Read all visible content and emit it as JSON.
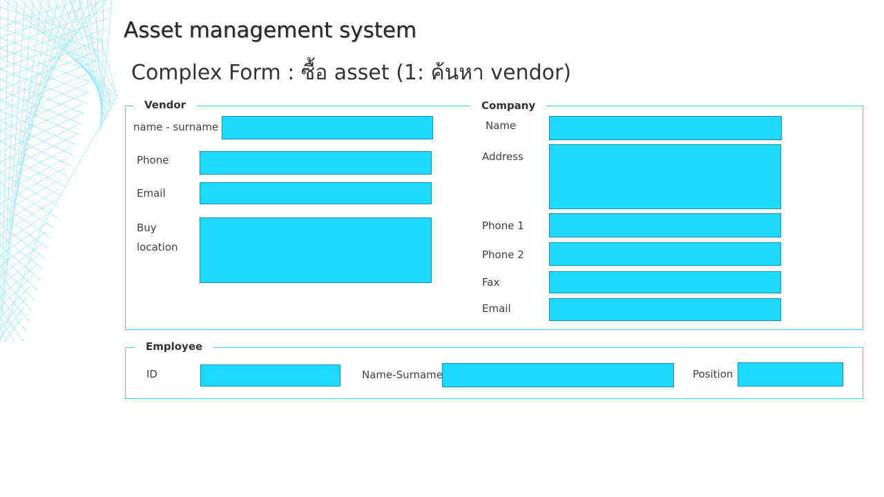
{
  "header": {
    "title": "Asset management system",
    "subtitle": "Complex Form : ซื้อ asset (1: ค้นหา vendor)"
  },
  "vendor": {
    "legend": "Vendor",
    "name_label": "name - surname",
    "name_value": "",
    "phone_label": "Phone",
    "phone_value": "",
    "email_label": "Email",
    "email_value": "",
    "buy_label_1": "Buy",
    "buy_label_2": "location",
    "buy_value": ""
  },
  "company": {
    "legend": "Company",
    "name_label": "Name",
    "name_value": "",
    "address_label": "Address",
    "address_value": "",
    "phone1_label": "Phone 1",
    "phone1_value": "",
    "phone2_label": "Phone 2",
    "phone2_value": "",
    "fax_label": "Fax",
    "fax_value": "",
    "email_label": "Email",
    "email_value": ""
  },
  "employee": {
    "legend": "Employee",
    "id_label": "ID",
    "id_value": "",
    "name_label": "Name-Surname",
    "name_value": "",
    "position_label": "Position",
    "position_value": ""
  },
  "colors": {
    "field_fill": "#1fd9fe",
    "panel_border": "#3fd0ee",
    "decoration": "#7fe3f5"
  }
}
